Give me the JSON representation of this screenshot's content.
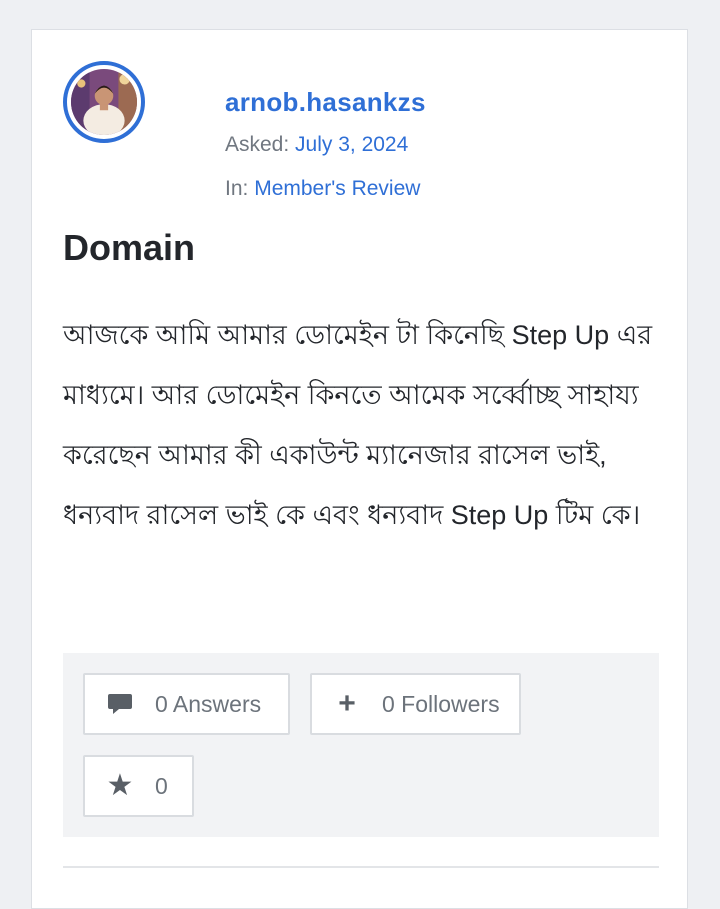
{
  "post": {
    "author": "arnob.hasankzs",
    "asked_label": "Asked:",
    "asked_date": "July 3, 2024",
    "in_label": "In:",
    "category": "Member's Review",
    "title": "Domain",
    "body": "আজকে আমি আমার ডোমেইন টা কিনেছি Step Up এর মাধ্যমে। আর ডোমেইন কিনতে আমেক সর্ব্বোচ্ছ সাহায্য করেছেন আমার কী একাউন্ট ম্যানেজার রাসেল ভাই,  ধন্যবাদ রাসেল ভাই কে এবং ধন্যবাদ Step Up  টিম কে।"
  },
  "stats": {
    "answers": "0 Answers",
    "followers": "0 Followers",
    "favorites": "0"
  },
  "icons": {
    "answers": "comment-icon",
    "followers": "plus-icon",
    "favorites": "star-icon"
  },
  "colors": {
    "accent": "#2f6fd6",
    "text": "#23262b",
    "muted": "#707780",
    "stats_bg": "#f2f3f5"
  }
}
